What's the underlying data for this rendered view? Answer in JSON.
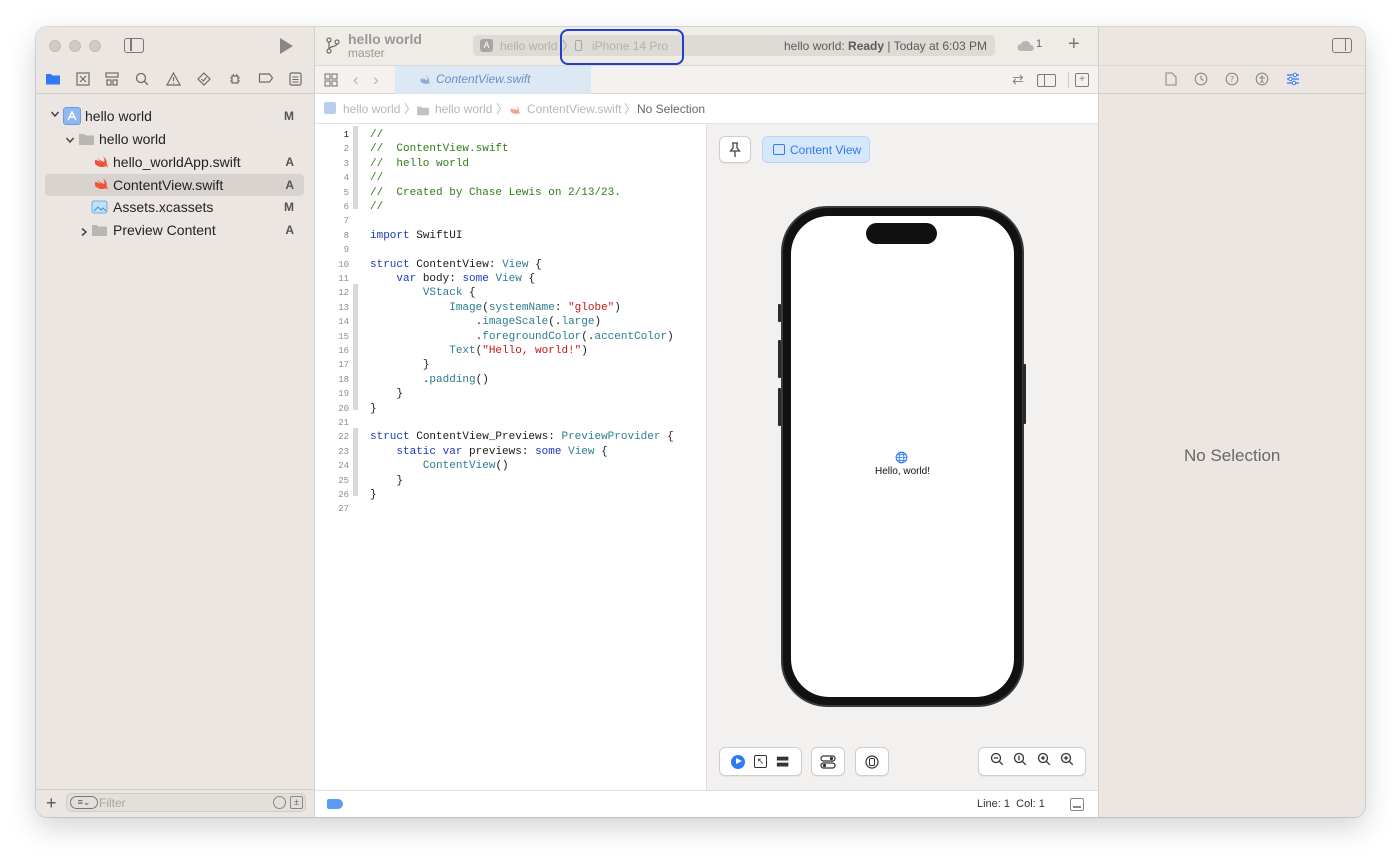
{
  "project": {
    "name": "hello world",
    "branch": "master"
  },
  "scheme": {
    "app": "hello world",
    "device": "iPhone 14 Pro",
    "status_prefix": "hello world: ",
    "status_state": "Ready",
    "status_time": " | Today at 6:03 PM",
    "cloud_count": "1"
  },
  "navigator": {
    "items": [
      {
        "label": "hello world",
        "badge": "M"
      },
      {
        "label": "hello world",
        "badge": ""
      },
      {
        "label": "hello_worldApp.swift",
        "badge": "A"
      },
      {
        "label": "ContentView.swift",
        "badge": "A"
      },
      {
        "label": "Assets.xcassets",
        "badge": "M"
      },
      {
        "label": "Preview Content",
        "badge": "A"
      }
    ],
    "filter_placeholder": "Filter"
  },
  "editor": {
    "tab_label": "ContentView.swift",
    "breadcrumb": [
      "hello world",
      "hello world",
      "ContentView.swift",
      "No Selection"
    ]
  },
  "code": {
    "line_numbers": [
      "1",
      "2",
      "3",
      "4",
      "5",
      "6",
      "7",
      "8",
      "9",
      "10",
      "11",
      "12",
      "13",
      "14",
      "15",
      "16",
      "17",
      "18",
      "19",
      "20",
      "21",
      "22",
      "23",
      "24",
      "25",
      "26",
      "27"
    ],
    "comment_1": "//",
    "comment_2": "//  ContentView.swift",
    "comment_3": "//  hello world",
    "comment_4": "//",
    "comment_5": "//  Created by Chase Lewis on 2/13/23.",
    "comment_6": "//",
    "kw_import": "import",
    "mod_swiftui": "SwiftUI",
    "kw_struct": "struct",
    "type_contentview": "ContentView",
    "colon": ":",
    "type_view": "View",
    "brace_open": "{",
    "kw_var": "var",
    "id_body": "body",
    "kw_some": "some",
    "type_vstack": "VStack",
    "call_image": "Image",
    "paren_open": "(",
    "arg_systemname": "systemName",
    "str_globe": "\"globe\"",
    "paren_close": ")",
    "dot": ".",
    "m_imagescale": "imageScale",
    "m_large": "large",
    "m_foregroundcolor": "foregroundColor",
    "m_accentcolor": "accentColor",
    "call_text": "Text",
    "str_hello": "\"Hello, world!\"",
    "brace_close": "}",
    "m_padding": "padding",
    "parens": "()",
    "type_previews": "ContentView_Previews",
    "type_previewprovider": "PreviewProvider",
    "kw_static": "static",
    "id_previews": "previews",
    "call_contentview": "ContentView"
  },
  "preview": {
    "chip_label": "Content View",
    "hello_text": "Hello, world!"
  },
  "statusbar": {
    "line_label": "Line:",
    "line_value": "1",
    "col_label": "Col:",
    "col_value": "1"
  },
  "inspector": {
    "empty_label": "No Selection"
  },
  "colors": {
    "accent": "#2f7bf6",
    "highlight_ring": "#1f3fd1",
    "comment": "#2f7d19",
    "keyword": "#1a3bbf",
    "string": "#c41a16",
    "type": "#2d7c91"
  }
}
